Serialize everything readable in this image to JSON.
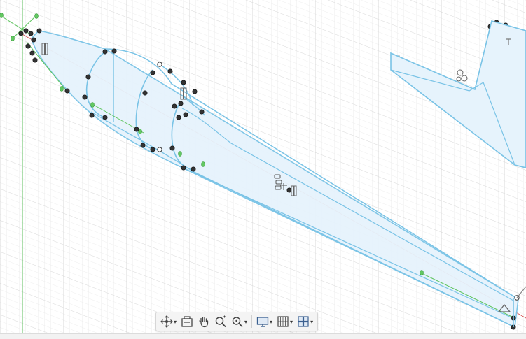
{
  "canvas": {
    "grid_minor_color": "#e6e6e6",
    "grid_major_color": "#d4d4d4",
    "body_fill": "#e3f1fb",
    "body_stroke": "#7cc4e6",
    "axis_red": "#d24b4b",
    "axis_green": "#3fae3f",
    "handle_color": "#3c3c3c",
    "tangent_color": "#5cc45c"
  },
  "toolbar": {
    "items": [
      {
        "id": "orbit",
        "icon": "orbit-icon",
        "has_menu": true
      },
      {
        "id": "look-at",
        "icon": "look-at-icon",
        "has_menu": false
      },
      {
        "id": "pan",
        "icon": "pan-hand-icon",
        "has_menu": false
      },
      {
        "id": "zoom",
        "icon": "zoom-icon",
        "has_menu": false
      },
      {
        "id": "fit",
        "icon": "zoom-window-icon",
        "has_menu": true
      },
      {
        "id": "display",
        "icon": "display-settings-icon",
        "has_menu": true
      },
      {
        "id": "grid",
        "icon": "grid-snap-icon",
        "has_menu": true
      },
      {
        "id": "viewports",
        "icon": "viewports-icon",
        "has_menu": true
      }
    ]
  }
}
